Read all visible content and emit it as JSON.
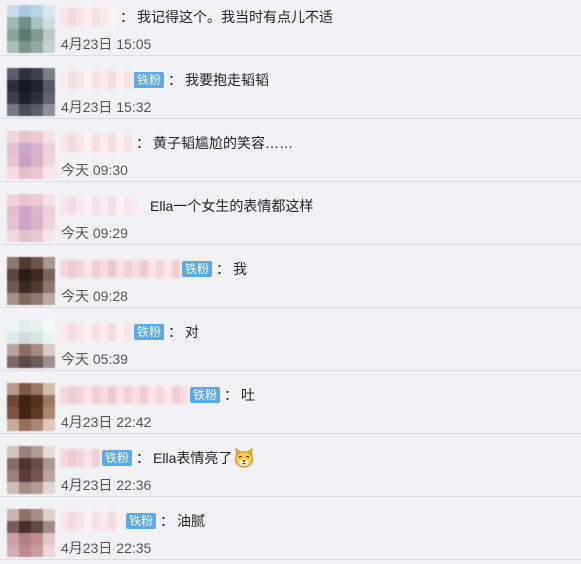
{
  "comments": [
    {
      "badge": "",
      "separator": "：",
      "text": "我记得这个。我当时有点儿不适",
      "time": "4月23日 15:05",
      "avatar_colors": [
        "#c9dbe8",
        "#a9c7e3",
        "#b7d4e9",
        "#d8e6ef",
        "#9fb8b4",
        "#6f9089",
        "#a6c2c6",
        "#cfdde3",
        "#8aa39b",
        "#5d7a6f",
        "#7f9a8f",
        "#b8c9c6",
        "#a8bdb6",
        "#7e958c",
        "#93aaa2",
        "#c3d2cf"
      ],
      "name_colors": [
        "#f7e6e8",
        "#f3d9dc",
        "#f6e2e4",
        "#fbeef0",
        "#f5dde1",
        "#f8e8ea",
        "#fcf2f3"
      ]
    },
    {
      "badge": "铁粉",
      "separator": "：",
      "text": "我要抱走韬韬",
      "time": "4月23日 15:32",
      "avatar_colors": [
        "#5a5f6b",
        "#2c3240",
        "#3d4250",
        "#7b7f88",
        "#2a2f3d",
        "#141821",
        "#1f2430",
        "#545968",
        "#3a3f4d",
        "#1b1f2a",
        "#2b303c",
        "#5f6370",
        "#777b86",
        "#4a4e5a",
        "#5b5f6b",
        "#8d909a"
      ],
      "name_colors": [
        "#f9ecee",
        "#f4dee1",
        "#f7e5e8",
        "#fcf3f4",
        "#f5e0e3",
        "#f9ebed",
        "#f3dadd",
        "#fbf0f1",
        "#f6e3e6"
      ]
    },
    {
      "badge": "",
      "separator": "：",
      "text": "黄子韬尴尬的笑容……",
      "time": "今天 09:30",
      "avatar_colors": [
        "#f1d6dc",
        "#e8c3cf",
        "#ecc9d3",
        "#f5e2e6",
        "#e4bfd0",
        "#cca5c8",
        "#d9b4cc",
        "#eed0da",
        "#e7c4d0",
        "#c9a0c2",
        "#d8b2c9",
        "#efd4dc",
        "#f2dbe1",
        "#e3bfcc",
        "#e9c7d2",
        "#f6e5e9"
      ],
      "name_colors": [
        "#f8e6e9",
        "#f2d9dd",
        "#f7e4e7",
        "#fcf1f3",
        "#f4dde1",
        "#f9ebee",
        "#f3dbdf",
        "#fbeff1",
        "#f6e1e5"
      ]
    },
    {
      "badge": "",
      "separator": "",
      "text": "Ella一个女生的表情都这样",
      "time": "今天 09:29",
      "avatar_colors": [
        "#efd1da",
        "#e7c2cf",
        "#eccad5",
        "#f4e0e6",
        "#e2bdd0",
        "#cfa6c9",
        "#dab5cd",
        "#edcfda",
        "#e6c3d1",
        "#cda4c6",
        "#dab3cb",
        "#eed2dc",
        "#f0d8df",
        "#e2c0cd",
        "#e8c8d3",
        "#f5e4e9"
      ],
      "name_colors": [
        "#f6e6f1",
        "#f2dbe7",
        "#f8e8f2",
        "#fbeff5",
        "#f3e0eb",
        "#f9ecf3",
        "#f2dde8",
        "#fcf3f7",
        "#f6e4ee",
        "#f9edf3"
      ]
    },
    {
      "badge": "铁粉",
      "separator": "：",
      "text": "我",
      "time": "今天 09:28",
      "avatar_colors": [
        "#8a7770",
        "#4e3a33",
        "#6a544b",
        "#a8968f",
        "#5b463d",
        "#2a1c17",
        "#3c2a23",
        "#7a655b",
        "#6e5a51",
        "#3a2821",
        "#4f3b33",
        "#8b776d",
        "#a3928a",
        "#7d6a61",
        "#8c7a71",
        "#b9aaa2"
      ],
      "name_colors": [
        "#f5d7dc",
        "#efc9d0",
        "#f3d1d8",
        "#f9e4e8",
        "#f1ccd3",
        "#f6dbe0",
        "#eec5cd",
        "#f8e0e5",
        "#f2cfd6",
        "#f7dde2",
        "#f0c8cf",
        "#f9e3e7",
        "#f4d4da",
        "#fae8eb",
        "#f1cbd2"
      ]
    },
    {
      "badge": "铁粉",
      "separator": "：",
      "text": "对",
      "time": "今天 05:39",
      "avatar_colors": [
        "#eef4f3",
        "#e2ecea",
        "#e9f1ef",
        "#f4f8f7",
        "#dfe9e7",
        "#cfdcd9",
        "#d9e5e2",
        "#ecf2f0",
        "#b9a29c",
        "#8c6e66",
        "#a38a83",
        "#d8cbc7",
        "#7a6b69",
        "#5a4a48",
        "#6b5b59",
        "#9c8f8c"
      ],
      "name_colors": [
        "#f9e9ec",
        "#f4dde1",
        "#f8e6e9",
        "#fcf2f4",
        "#f5e0e4",
        "#f9ebee",
        "#f3dbdf",
        "#fbeff1",
        "#f6e3e6"
      ]
    },
    {
      "badge": "铁粉",
      "separator": "：",
      "text": "吐",
      "time": "4月23日 22:42",
      "avatar_colors": [
        "#b89a88",
        "#7e5a45",
        "#9a7661",
        "#d3bcae",
        "#6e4733",
        "#3d2216",
        "#55331f",
        "#9b7865",
        "#7d5440",
        "#43261a",
        "#5e3a27",
        "#a88673",
        "#c7ab9b",
        "#956f5b",
        "#aa8674",
        "#dcc8bc"
      ],
      "name_colors": [
        "#f5d9de",
        "#efcbd2",
        "#f3d3d9",
        "#f9e6e9",
        "#f1ced4",
        "#f6dce1",
        "#eec7ce",
        "#f8e2e6",
        "#f2d0d7",
        "#f7dfe3",
        "#f0cad1",
        "#f9e5e8",
        "#f4d6dc",
        "#fae9ec",
        "#f1cdd3",
        "#f7dde1"
      ]
    },
    {
      "badge": "铁粉",
      "separator": "：",
      "text": "Ella表情亮了",
      "time": "4月23日 22:36",
      "avatar_colors": [
        "#d2c4c0",
        "#9a807b",
        "#b29a95",
        "#e4dad7",
        "#8a6c66",
        "#4e3530",
        "#6a4f49",
        "#ad9690",
        "#9c807a",
        "#5a3f39",
        "#74574f",
        "#b9a49e",
        "#cdbdb8",
        "#a48b85",
        "#b39c96",
        "#e0d5d2"
      ],
      "name_colors": [
        "#f4d8dd",
        "#eecad0",
        "#f2d2d8",
        "#f8e5e8",
        "#f0cdd3"
      ]
    },
    {
      "badge": "铁粉",
      "separator": "：",
      "text": "油腻",
      "time": "4月23日 22:35",
      "avatar_colors": [
        "#c8b5b2",
        "#8e706b",
        "#a88c87",
        "#ddd0ce",
        "#7c5e59",
        "#4a302c",
        "#644843",
        "#a58b86",
        "#c9a0a3",
        "#b57d82",
        "#c08e92",
        "#e2c7c9",
        "#d2aeb1",
        "#c0898e",
        "#c99ca0",
        "#ecd6d8"
      ],
      "name_colors": [
        "#f8e6e9",
        "#f3d9dd",
        "#f7e3e7",
        "#fcf1f3",
        "#f5dde1",
        "#f9eaed",
        "#f3dadf",
        "#fbeef1"
      ]
    }
  ],
  "emoji": {
    "row_index": 7,
    "name": "doge-face-emoji",
    "face_color": "#f7c948",
    "outline_color": "#b07a1a"
  }
}
